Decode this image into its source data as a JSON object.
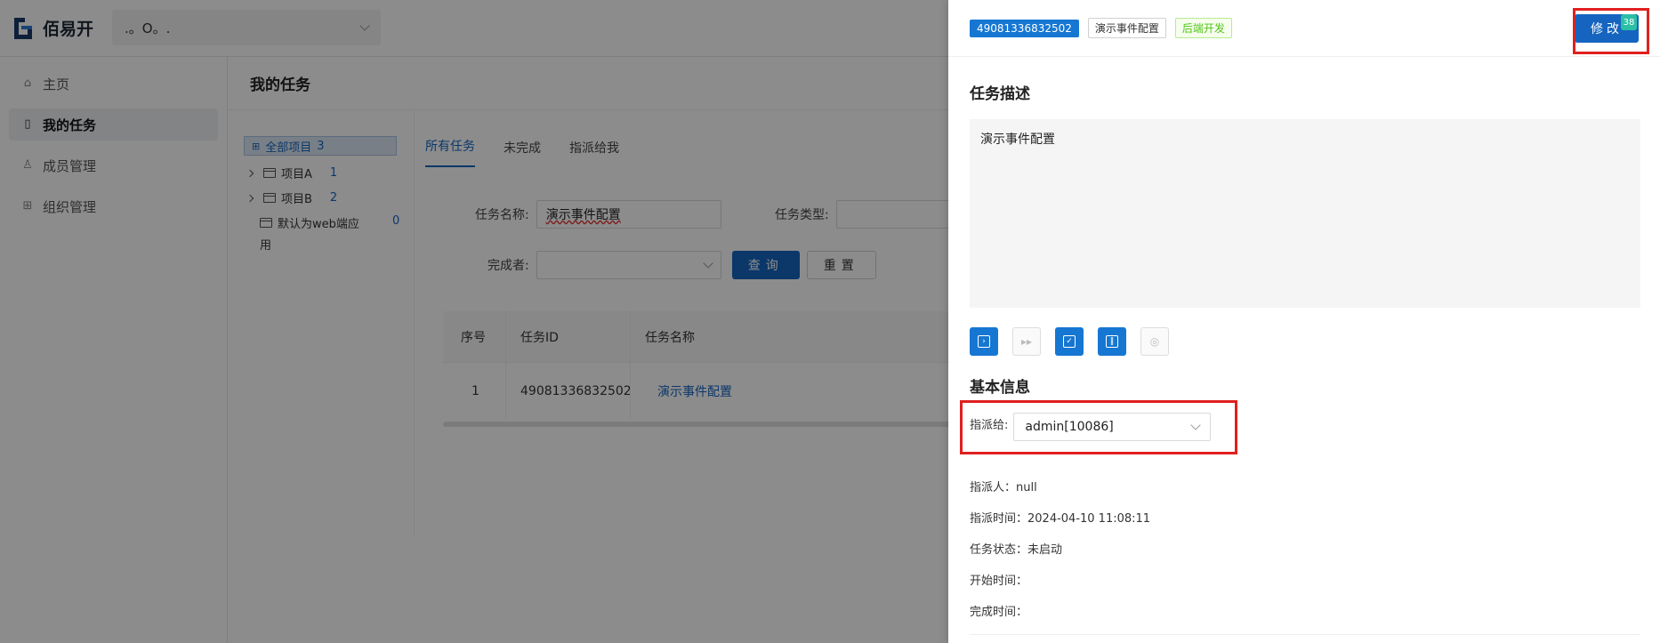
{
  "app": {
    "name": "佰易开",
    "workspace": ".。O。."
  },
  "sidebar": {
    "items": [
      {
        "label": "主页",
        "icon": "home-icon"
      },
      {
        "label": "我的任务",
        "icon": "file-icon",
        "active": true
      },
      {
        "label": "成员管理",
        "icon": "user-icon"
      },
      {
        "label": "组织管理",
        "icon": "org-icon"
      }
    ]
  },
  "main": {
    "title": "我的任务",
    "tree": {
      "root": {
        "label": "全部项目",
        "count": "3"
      },
      "nodes": [
        {
          "label": "项目A",
          "count": "1"
        },
        {
          "label": "项目B",
          "count": "2"
        },
        {
          "label": "默认为web端应",
          "label2": "用",
          "count": "0"
        }
      ]
    },
    "tabs": [
      "所有任务",
      "未完成",
      "指派给我"
    ],
    "filters": {
      "name_label": "任务名称:",
      "name_value": "演示事件配置",
      "type_label": "任务类型:",
      "finisher_label": "完成者:",
      "query_btn": "查询",
      "reset_btn": "重置"
    },
    "table": {
      "headers": [
        "序号",
        "任务ID",
        "任务名称"
      ],
      "rows": [
        {
          "idx": "1",
          "id": "49081336832502",
          "name": "演示事件配置"
        }
      ]
    }
  },
  "drawer": {
    "tag_id": "49081336832502",
    "tag_name": "演示事件配置",
    "tag_type": "后端开发",
    "edit_btn": "修改",
    "edit_badge": "38",
    "desc_title": "任务描述",
    "desc_text": "演示事件配置",
    "basic_title": "基本信息",
    "assign_label": "指派给:",
    "assign_value": "admin[10086]",
    "info": {
      "assigner": "指派人：null",
      "assign_time": "指派时间：2024-04-10 11:08:11",
      "status": "任务状态：未启动",
      "start_time": "开始时间：",
      "finish_time": "完成时间："
    },
    "colors": {
      "primary": "#1565c0",
      "highlight": "#e0201f",
      "type_tag": "#52c41a"
    }
  }
}
